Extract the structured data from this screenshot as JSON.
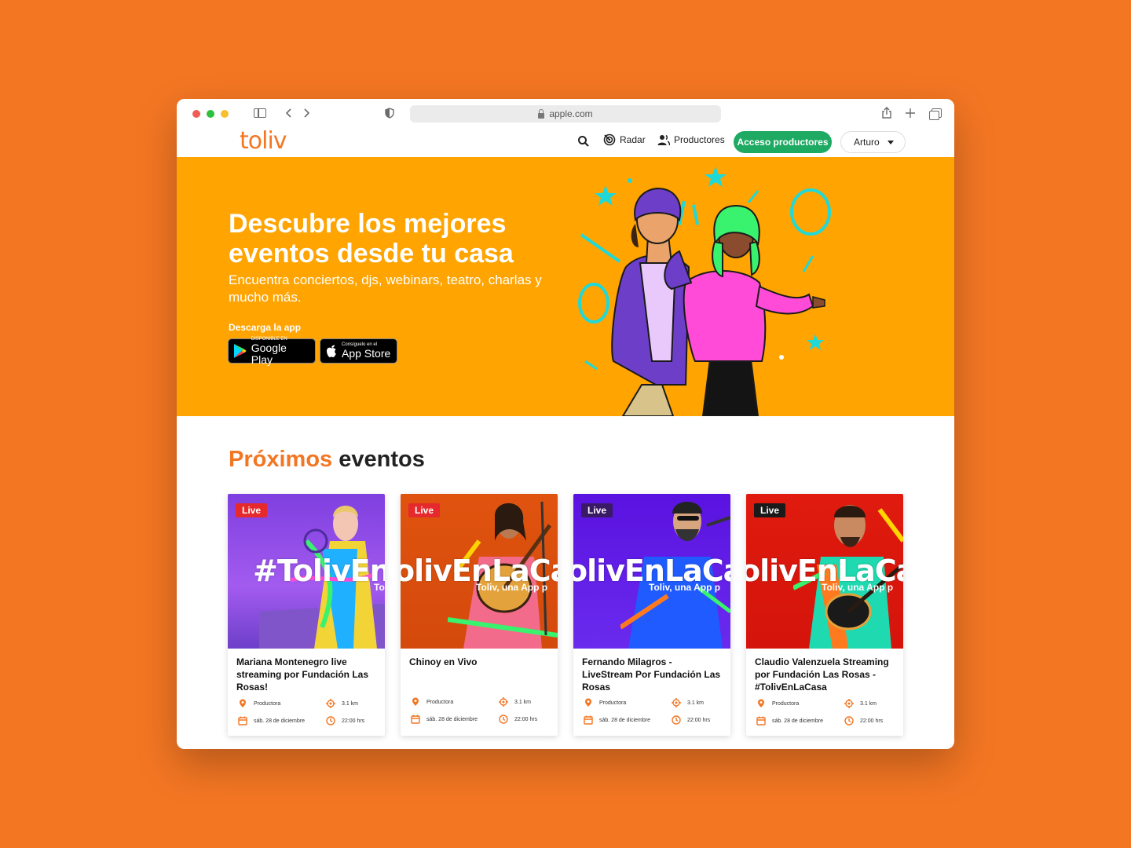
{
  "browser": {
    "url": "apple.com"
  },
  "site": {
    "logo": "toliv",
    "nav": {
      "radar_label": "Radar",
      "productores_label": "Productores",
      "acceso_button": "Acceso productores",
      "user_name": "Arturo"
    }
  },
  "hero": {
    "title": "Descubre los mejores eventos desde tu casa",
    "subtitle": "Encuentra conciertos, djs, webinars, teatro, charlas y mucho más.",
    "download_label": "Descarga la app",
    "google_play_small": "DISPONIBLE EN",
    "google_play_big": "Google Play",
    "app_store_small": "Consíguelo en el",
    "app_store_big": "App Store"
  },
  "events": {
    "title_accent": "Próximos",
    "title_rest": "eventos",
    "items": [
      {
        "live": "Live",
        "overlay": "#TolivEn",
        "overlay_sub": "To",
        "title": "Mariana Montenegro live streaming por Fundación Las Rosas!",
        "producer": "Productora",
        "distance": "3.1 km",
        "date": "sáb. 28 de diciembre",
        "time": "22:00 hrs"
      },
      {
        "live": "Live",
        "overlay": "olivEnLaCa",
        "overlay_sub": "Toliv, una App p",
        "title": "Chinoy en Vivo",
        "producer": "Productora",
        "distance": "3.1 km",
        "date": "sáb. 28 de diciembre",
        "time": "22:00 hrs"
      },
      {
        "live": "Live",
        "overlay": "olivEnLaCa",
        "overlay_sub": "Toliv, una App p",
        "title": "Fernando Milagros - LiveStream Por Fundación Las Rosas",
        "producer": "Productora",
        "distance": "3.1 km",
        "date": "sáb. 28 de diciembre",
        "time": "22:00 hrs"
      },
      {
        "live": "Live",
        "overlay": "olivEnLaCa",
        "overlay_sub": "Toliv, una App p",
        "title": "Claudio Valenzuela Streaming por Fundación Las Rosas - #TolivEnLaCasa",
        "producer": "Productora",
        "distance": "3.1 km",
        "date": "sáb. 28 de diciembre",
        "time": "22:00 hrs"
      }
    ]
  },
  "colors": {
    "brand_orange": "#F37623",
    "hero_yellow": "#FFA400",
    "green_button": "#1EAA63",
    "live_red": "#E5292C",
    "live_dark": "#3A1A66"
  }
}
